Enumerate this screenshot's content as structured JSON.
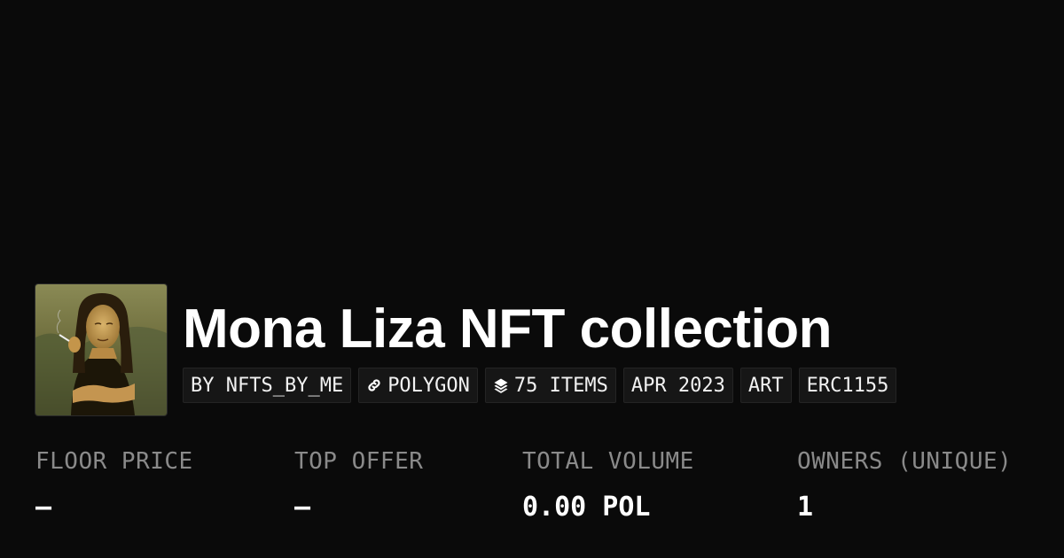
{
  "collection": {
    "title": "Mona Liza NFT collection",
    "avatar_icon": "mona-lisa-portrait"
  },
  "tags": [
    {
      "label": "BY NFTS_BY_ME"
    },
    {
      "label": "POLYGON",
      "icon": "link-icon"
    },
    {
      "label": "75 ITEMS",
      "icon": "layers-icon"
    },
    {
      "label": "APR 2023"
    },
    {
      "label": "ART"
    },
    {
      "label": "ERC1155"
    }
  ],
  "stats": [
    {
      "label": "FLOOR PRICE",
      "value": "–"
    },
    {
      "label": "TOP OFFER",
      "value": "–"
    },
    {
      "label": "TOTAL VOLUME",
      "value": "0.00 POL"
    },
    {
      "label": "OWNERS (UNIQUE)",
      "value": "1"
    }
  ],
  "colors": {
    "background": "#0a0a0a",
    "text": "#ffffff",
    "muted": "#8a8a8a",
    "tag_bg": "#161616"
  }
}
